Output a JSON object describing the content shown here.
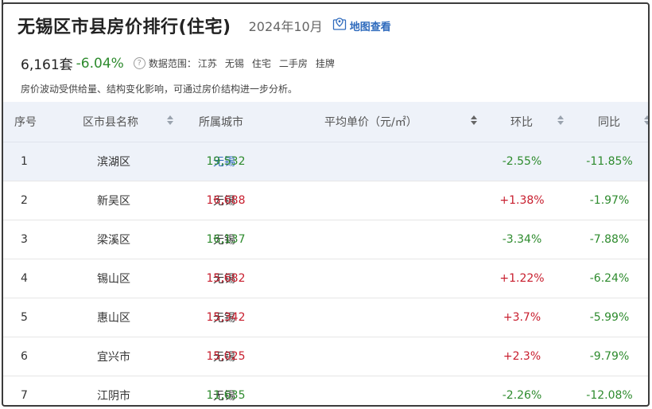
{
  "header": {
    "title": "无锡区市县房价排行(住宅)",
    "period": "2024年10月",
    "map_link": "地图查看"
  },
  "stats": {
    "count": "6,161套",
    "change": "-6.04%",
    "scope_label": "数据范围：",
    "scope_values": [
      "江苏",
      "无锡",
      "住宅",
      "二手房",
      "挂牌"
    ]
  },
  "note": "房价波动受供给量、结构变化影响，可通过房价结构进一步分析。",
  "table": {
    "columns": [
      "序号",
      "区市县名称",
      "所属城市",
      "平均单价（元/㎡）",
      "环比",
      "同比"
    ],
    "rows": [
      {
        "idx": "1",
        "name": "滨湖区",
        "city": "无锡",
        "price": "19,532",
        "mom": "-2.55%",
        "yoy": "-11.85%"
      },
      {
        "idx": "2",
        "name": "新吴区",
        "city": "无锡",
        "price": "16,688",
        "mom": "+1.38%",
        "yoy": "-1.97%"
      },
      {
        "idx": "3",
        "name": "梁溪区",
        "city": "无锡",
        "price": "16,137",
        "mom": "-3.34%",
        "yoy": "-7.88%"
      },
      {
        "idx": "4",
        "name": "锡山区",
        "city": "无锡",
        "price": "15,682",
        "mom": "+1.22%",
        "yoy": "-6.24%"
      },
      {
        "idx": "5",
        "name": "惠山区",
        "city": "无锡",
        "price": "15,342",
        "mom": "+3.7%",
        "yoy": "-5.99%"
      },
      {
        "idx": "6",
        "name": "宜兴市",
        "city": "无锡",
        "price": "15,025",
        "mom": "+2.3%",
        "yoy": "-9.79%"
      },
      {
        "idx": "7",
        "name": "江阴市",
        "city": "无锡",
        "price": "11,635",
        "mom": "-2.26%",
        "yoy": "-12.08%"
      }
    ]
  },
  "colors": {
    "accent": "#2f6bbd",
    "positive": "#c81e2e",
    "negative": "#2e8b2e",
    "header_bg": "#eef2f9"
  }
}
